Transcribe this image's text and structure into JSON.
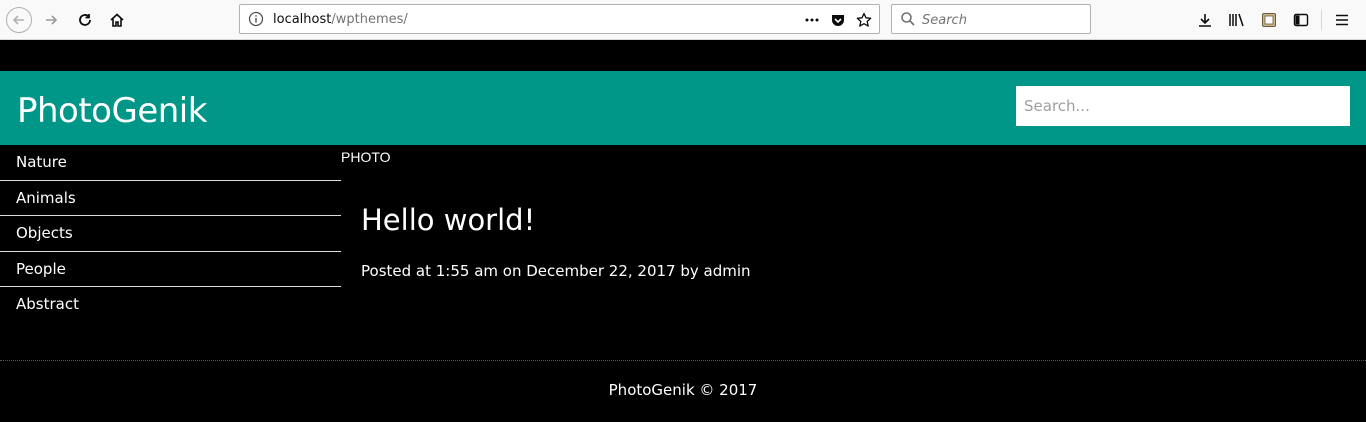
{
  "browser": {
    "url_host": "localhost",
    "url_path": "/wpthemes/",
    "search_placeholder": "Search",
    "icons": {
      "back": "arrow-left-icon",
      "forward": "arrow-right-icon",
      "reload": "reload-icon",
      "home": "home-icon",
      "info": "info-icon",
      "more": "more-dots-icon",
      "pocket": "pocket-icon",
      "bookmark": "star-icon",
      "search": "magnifier-icon",
      "download": "download-icon",
      "library": "library-icon",
      "screenshot": "screenshot-icon",
      "sidebar": "sidebar-icon",
      "menu": "hamburger-menu-icon"
    }
  },
  "site": {
    "title": "PhotoGenik",
    "search_placeholder": "Search...",
    "accent_color": "#009688"
  },
  "sidebar": {
    "items": [
      {
        "label": "Nature"
      },
      {
        "label": "Animals"
      },
      {
        "label": "Objects"
      },
      {
        "label": "People"
      },
      {
        "label": "Abstract"
      }
    ]
  },
  "main": {
    "category": "PHOTO",
    "post": {
      "title": "Hello world!",
      "meta": "Posted at 1:55 am on December 22, 2017 by admin"
    }
  },
  "footer": {
    "text": "PhotoGenik © 2017"
  }
}
